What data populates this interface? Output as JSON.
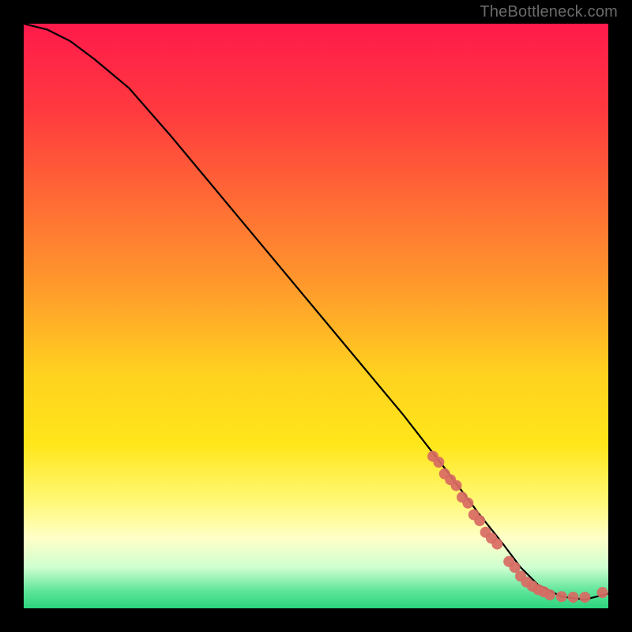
{
  "watermark": "TheBottleneck.com",
  "chart_data": {
    "type": "line",
    "title": "",
    "xlabel": "",
    "ylabel": "",
    "xlim": [
      0,
      100
    ],
    "ylim": [
      0,
      100
    ],
    "grid": false,
    "gradient_stops": [
      {
        "offset": 0.0,
        "color": "#ff1a4b"
      },
      {
        "offset": 0.15,
        "color": "#ff3a3f"
      },
      {
        "offset": 0.3,
        "color": "#ff6a35"
      },
      {
        "offset": 0.45,
        "color": "#ff9a2c"
      },
      {
        "offset": 0.6,
        "color": "#ffd21f"
      },
      {
        "offset": 0.72,
        "color": "#ffe61a"
      },
      {
        "offset": 0.82,
        "color": "#fff97a"
      },
      {
        "offset": 0.88,
        "color": "#ffffc8"
      },
      {
        "offset": 0.93,
        "color": "#cfffd0"
      },
      {
        "offset": 0.97,
        "color": "#5fe59a"
      },
      {
        "offset": 1.0,
        "color": "#2bd47e"
      }
    ],
    "series": [
      {
        "name": "curve",
        "x": [
          0,
          4,
          8,
          12,
          18,
          25,
          35,
          45,
          55,
          65,
          72,
          78,
          82,
          85,
          88,
          92,
          96,
          100
        ],
        "y": [
          100,
          99,
          97,
          94,
          89,
          81,
          69,
          57,
          45,
          33,
          24,
          16,
          11,
          7,
          4,
          2,
          1.5,
          2.5
        ]
      }
    ],
    "scatter": [
      {
        "name": "points",
        "color": "#d86a63",
        "x": [
          70,
          71,
          72,
          73,
          74,
          75,
          76,
          77,
          78,
          79,
          80,
          81,
          83,
          84,
          85,
          86,
          87,
          88,
          89,
          90,
          92,
          94,
          96,
          99
        ],
        "y": [
          26,
          25,
          23,
          22,
          21,
          19,
          18,
          16,
          15,
          13,
          12,
          11,
          8,
          7,
          5.5,
          4.5,
          3.8,
          3.2,
          2.8,
          2.3,
          2.0,
          1.9,
          1.9,
          2.7
        ]
      }
    ]
  }
}
